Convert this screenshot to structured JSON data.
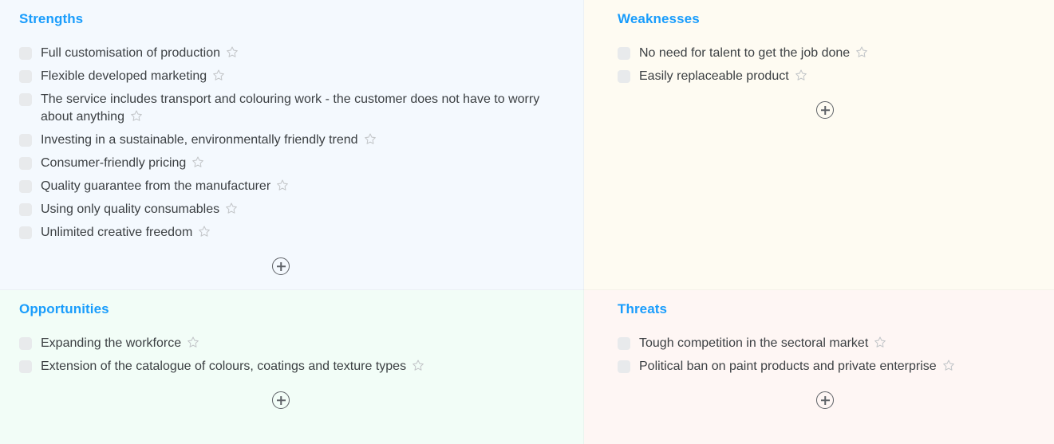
{
  "board": {
    "type": "swot-analysis",
    "accent_color": "#1a9dfc",
    "text_color": "#3c4043",
    "add_button_label": "+",
    "quadrants": [
      {
        "key": "strengths",
        "title": "Strengths",
        "background": "#f4f9fe",
        "items": [
          {
            "text": "Full customisation of production",
            "starred": false,
            "checked": false
          },
          {
            "text": "Flexible developed marketing",
            "starred": false,
            "checked": false
          },
          {
            "text": "The service includes transport and colouring work - the customer does not have to worry about anything",
            "starred": false,
            "checked": false
          },
          {
            "text": "Investing in a sustainable, environmentally friendly trend",
            "starred": false,
            "checked": false
          },
          {
            "text": "Consumer-friendly pricing",
            "starred": false,
            "checked": false
          },
          {
            "text": "Quality guarantee from the manufacturer",
            "starred": false,
            "checked": false
          },
          {
            "text": "Using only quality consumables",
            "starred": false,
            "checked": false
          },
          {
            "text": "Unlimited creative freedom",
            "starred": false,
            "checked": false
          }
        ]
      },
      {
        "key": "weaknesses",
        "title": "Weaknesses",
        "background": "#fefbf2",
        "items": [
          {
            "text": "No need for talent to get the job done",
            "starred": false,
            "checked": false
          },
          {
            "text": "Easily replaceable product",
            "starred": false,
            "checked": false
          }
        ]
      },
      {
        "key": "opportunities",
        "title": "Opportunities",
        "background": "#f2fdf7",
        "items": [
          {
            "text": "Expanding the workforce",
            "starred": false,
            "checked": false
          },
          {
            "text": "Extension of the catalogue of colours, coatings and texture types",
            "starred": false,
            "checked": false
          }
        ]
      },
      {
        "key": "threats",
        "title": "Threats",
        "background": "#fef6f4",
        "items": [
          {
            "text": "Tough competition in the sectoral market",
            "starred": false,
            "checked": false
          },
          {
            "text": "Political ban on paint products and private enterprise",
            "starred": false,
            "checked": false
          }
        ]
      }
    ]
  }
}
